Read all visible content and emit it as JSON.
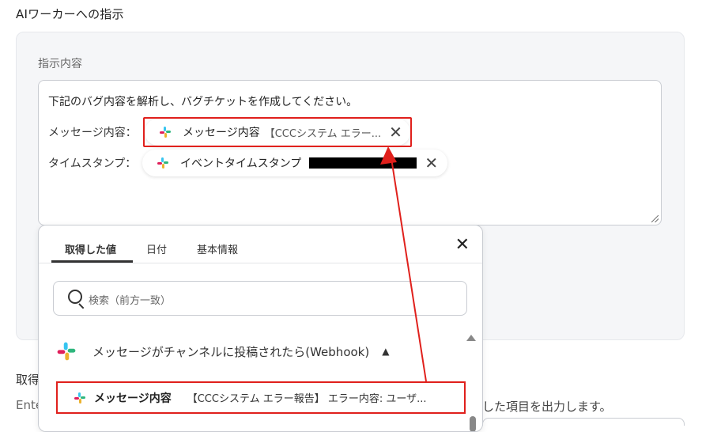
{
  "section": {
    "title": "AIワーカーへの指示"
  },
  "instruction": {
    "label": "指示内容",
    "line1": "下記のバグ内容を解析し、バグチケットを作成してください。",
    "line2_label": "メッセージ内容：",
    "chip1": {
      "name": "メッセージ内容",
      "preview": "【CCCシステム エラー..."
    },
    "line3_label": "タイムスタンプ：",
    "chip2": {
      "name": "イベントタイムスタンプ"
    }
  },
  "dropdown": {
    "tabs": [
      "取得した値",
      "日付",
      "基本情報"
    ],
    "active_tab": "取得した値",
    "search_placeholder": "検索（前方一致）",
    "group": {
      "title": "メッセージがチャンネルに投稿されたら(Webhook)"
    },
    "items": [
      {
        "name": "メッセージ内容",
        "preview": "【CCCシステム エラー報告】 エラー内容: ユーザ..."
      }
    ]
  },
  "background": {
    "partial_heading": "取得",
    "partial_desc_left": "Ente",
    "partial_desc_right": "した項目を出力します。"
  },
  "colors": {
    "highlight_red": "#e0201c",
    "panel_bg": "#f5f6f8"
  },
  "icons": [
    "slack-icon",
    "close-icon",
    "search-icon",
    "chevron-up-icon"
  ]
}
